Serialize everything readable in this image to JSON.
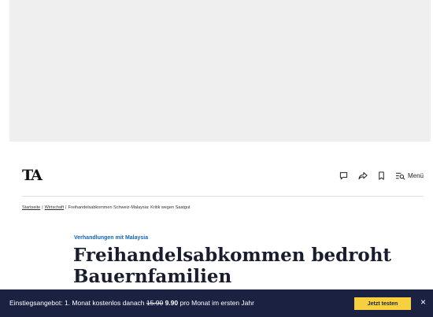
{
  "header": {
    "logo_text": "TA",
    "menu_label": "Menü",
    "icons": [
      "comment-icon",
      "share-icon",
      "bookmark-icon",
      "menu-search-icon"
    ]
  },
  "breadcrumb": {
    "items": [
      "Startseite",
      "Wirtschaft",
      "Freihandelsabkommen Schweiz-Malaysia: Kritik wegen Saatgut"
    ],
    "separator": "|"
  },
  "article": {
    "kicker": "Verhandlungen mit Malaysia",
    "headline": "Freihandelsabkommen bedroht Bauernfamilien"
  },
  "promo": {
    "text_before": "Einstiegsangebot: 1. Monat kostenlos danach ",
    "old_price": "15.90",
    "new_price": "9.90",
    "text_after": " pro Monat im ersten Jahr",
    "cta_label": "Jetzt testen",
    "close_icon": "×"
  },
  "colors": {
    "kicker": "#1262b8",
    "headline": "#1a1d2e",
    "promo_bg": "#1b2241",
    "cta_bg": "#f6d03e",
    "ad_bg": "#efefef"
  }
}
